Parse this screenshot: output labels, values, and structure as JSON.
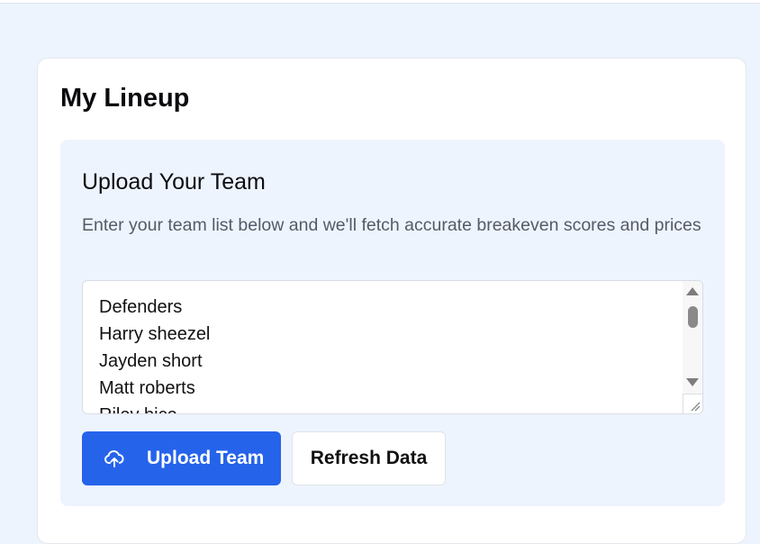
{
  "card": {
    "title": "My Lineup"
  },
  "upload_panel": {
    "title": "Upload Your Team",
    "description": "Enter your team list below and we'll fetch accurate breakeven scores and prices",
    "team_lines": [
      "Defenders",
      "Harry sheezel",
      "Jayden short",
      "Matt roberts",
      "Riley bice"
    ]
  },
  "buttons": {
    "upload_label": "Upload Team",
    "upload_icon": "cloud-upload-icon",
    "refresh_label": "Refresh Data"
  },
  "colors": {
    "primary": "#2563eb",
    "page_bg": "#eef4fd",
    "panel_bg": "#eef4fd"
  }
}
